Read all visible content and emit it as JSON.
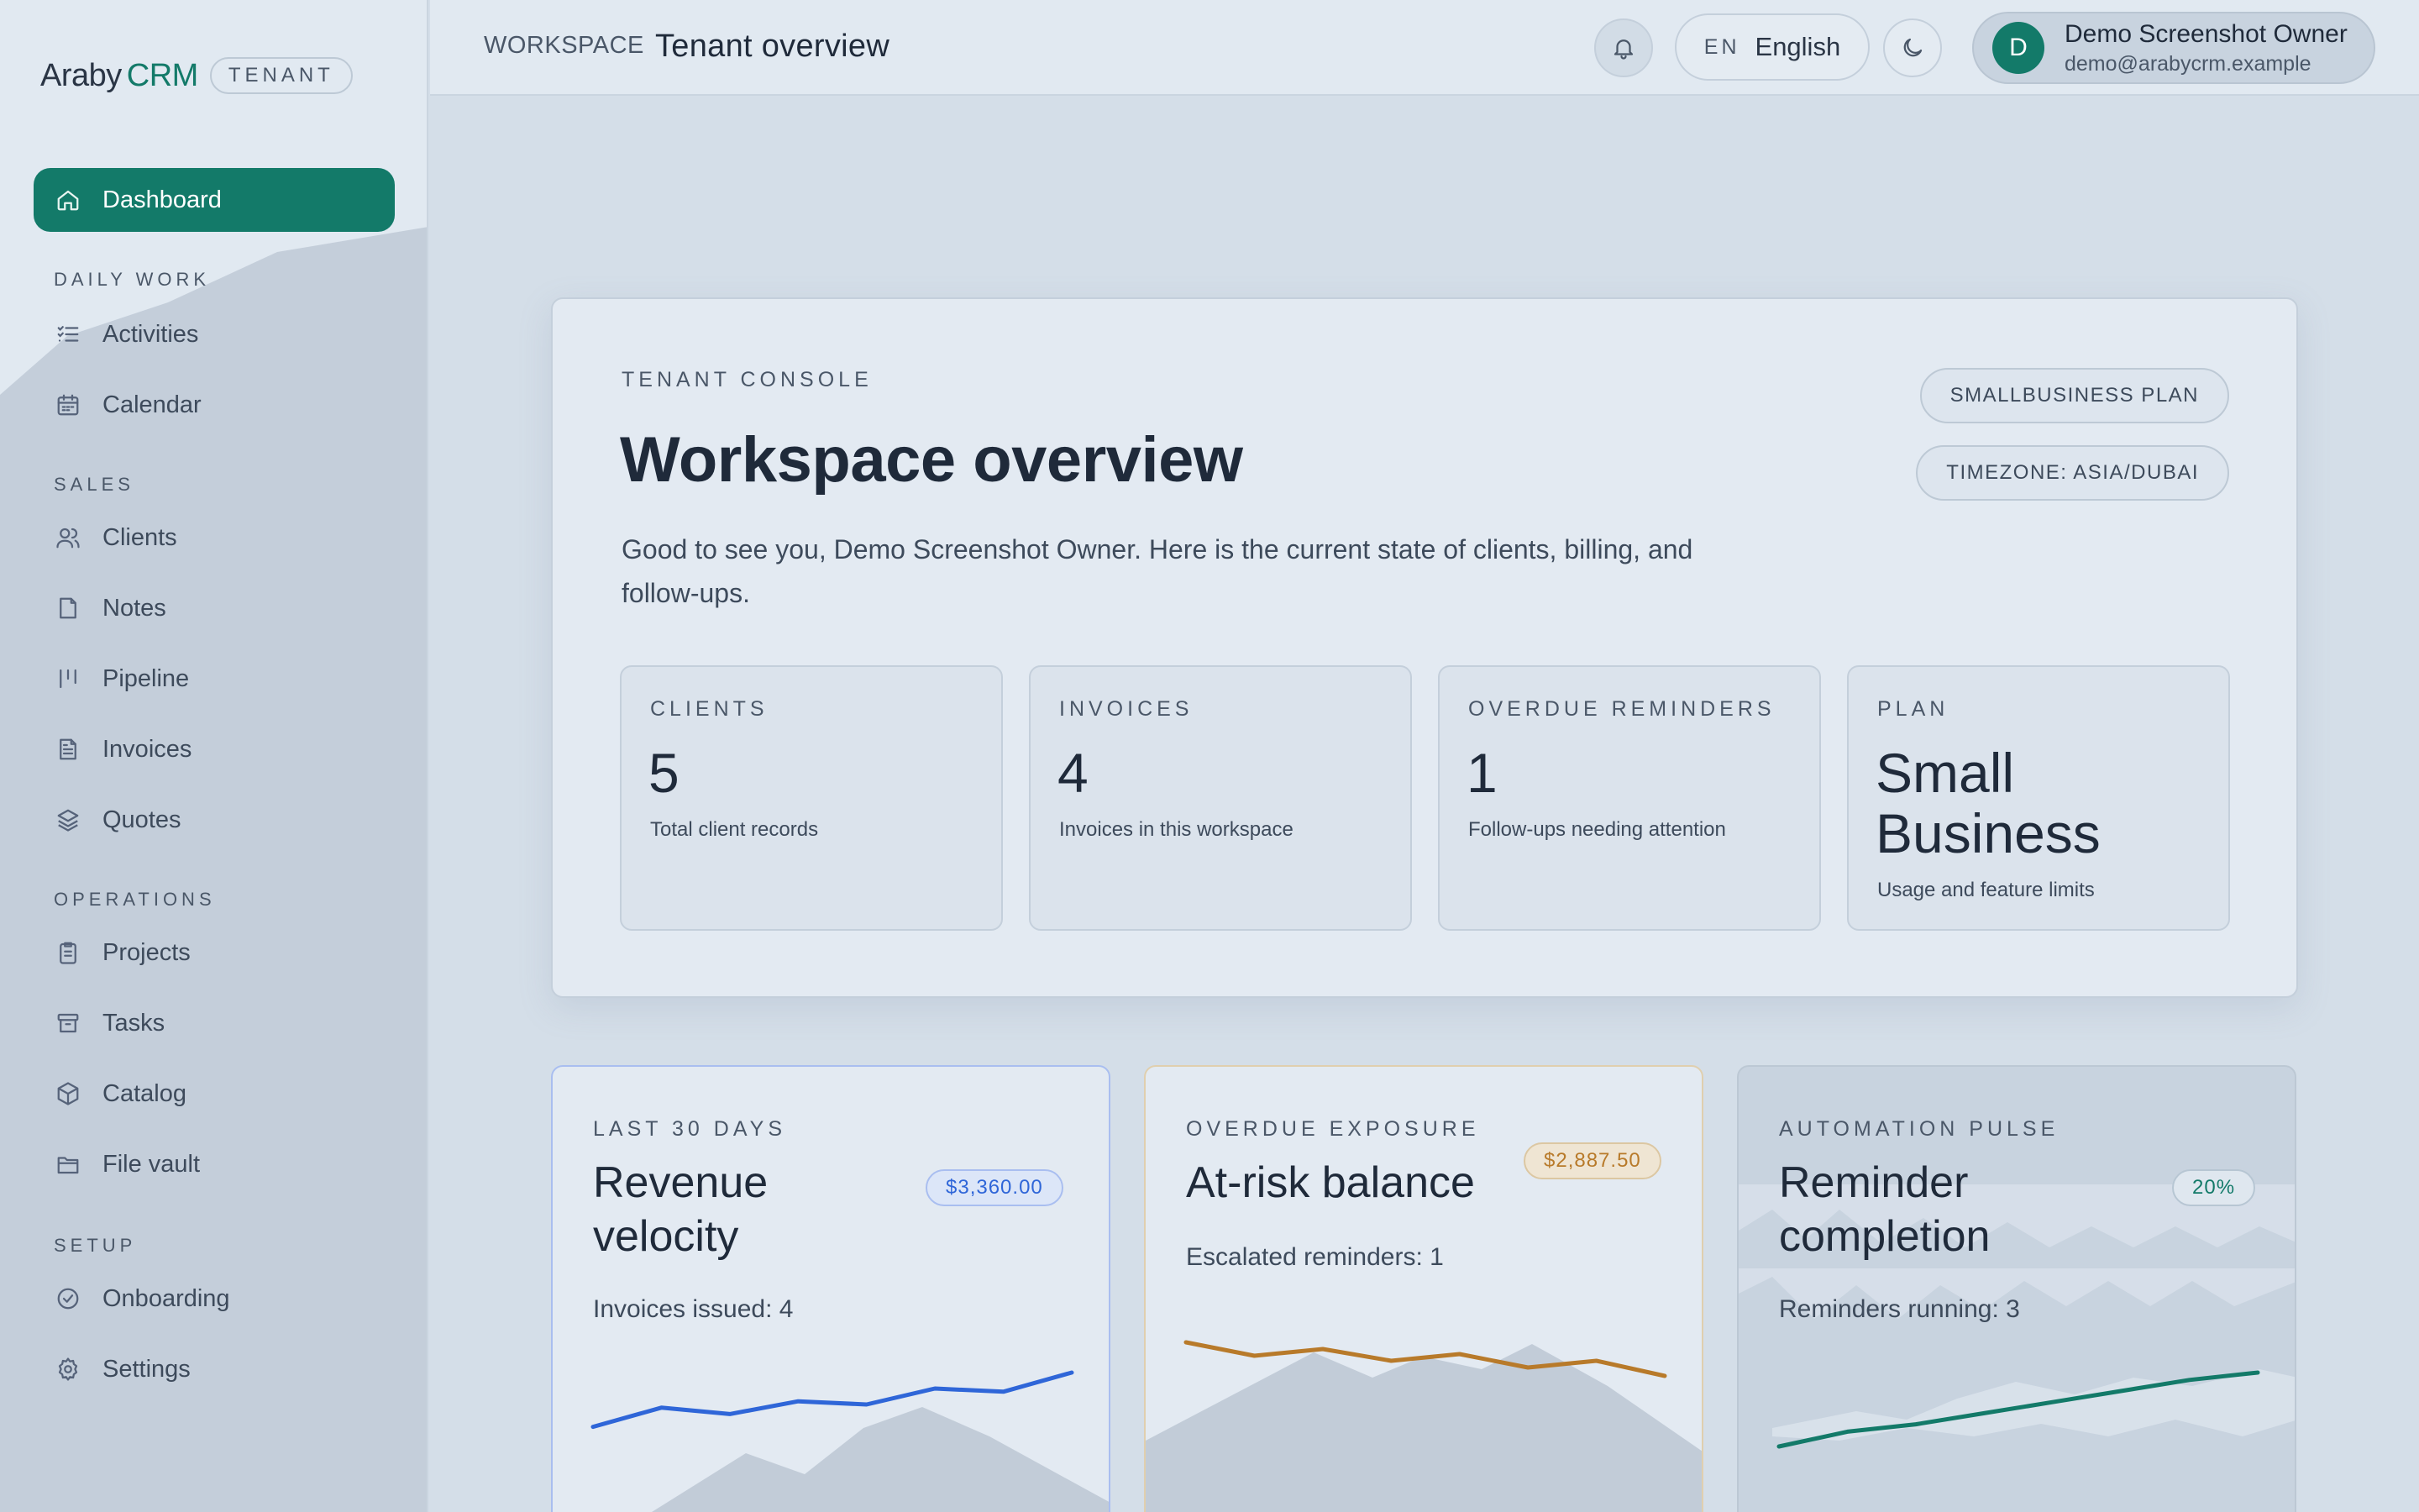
{
  "brand": {
    "name": "Araby",
    "accent": "CRM",
    "badge": "TENANT"
  },
  "sidebar": {
    "active": {
      "label": "Dashboard",
      "icon": "home-icon"
    },
    "sections": [
      {
        "title": "DAILY WORK",
        "items": [
          {
            "label": "Activities",
            "icon": "checklist-icon"
          },
          {
            "label": "Calendar",
            "icon": "calendar-icon"
          }
        ]
      },
      {
        "title": "SALES",
        "items": [
          {
            "label": "Clients",
            "icon": "users-icon"
          },
          {
            "label": "Notes",
            "icon": "note-icon"
          },
          {
            "label": "Pipeline",
            "icon": "pipeline-icon"
          },
          {
            "label": "Invoices",
            "icon": "invoice-icon"
          },
          {
            "label": "Quotes",
            "icon": "layers-icon"
          }
        ]
      },
      {
        "title": "OPERATIONS",
        "items": [
          {
            "label": "Projects",
            "icon": "clipboard-icon"
          },
          {
            "label": "Tasks",
            "icon": "archive-icon"
          },
          {
            "label": "Catalog",
            "icon": "package-icon"
          },
          {
            "label": "File vault",
            "icon": "folder-icon"
          }
        ]
      },
      {
        "title": "SETUP",
        "items": [
          {
            "label": "Onboarding",
            "icon": "check-circle-icon"
          },
          {
            "label": "Settings",
            "icon": "gear-icon"
          }
        ]
      }
    ]
  },
  "topbar": {
    "section": "WORKSPACE",
    "title": "Tenant overview",
    "language": {
      "code": "EN",
      "name": "English"
    },
    "user": {
      "initial": "D",
      "name": "Demo Screenshot Owner",
      "email": "demo@arabycrm.example"
    }
  },
  "console": {
    "eyebrow": "TENANT CONSOLE",
    "title": "Workspace overview",
    "description": "Good to see you, Demo Screenshot Owner. Here is the current state of clients, billing, and follow-ups.",
    "plan_pill": "SMALLBUSINESS PLAN",
    "timezone_pill": "TIMEZONE: ASIA/DUBAI",
    "stats": [
      {
        "label": "CLIENTS",
        "value": "5",
        "sub": "Total client records"
      },
      {
        "label": "INVOICES",
        "value": "4",
        "sub": "Invoices in this workspace"
      },
      {
        "label": "OVERDUE REMINDERS",
        "value": "1",
        "sub": "Follow-ups needing attention"
      },
      {
        "label": "PLAN",
        "value": "Small Business",
        "sub": "Usage and feature limits"
      }
    ]
  },
  "metrics": [
    {
      "eyebrow": "LAST 30 DAYS",
      "title": "Revenue velocity",
      "badge": "$3,360.00",
      "sub": "Invoices issued: 4",
      "color": "#2f66d8",
      "trend": [
        0.15,
        0.45,
        0.35,
        0.55,
        0.5,
        0.75,
        0.7,
        1.0
      ]
    },
    {
      "eyebrow": "OVERDUE EXPOSURE",
      "title": "At-risk balance",
      "badge": "$2,887.50",
      "sub": "Escalated reminders: 1",
      "color": "#b87a2a",
      "trend": [
        1.0,
        0.6,
        0.8,
        0.45,
        0.65,
        0.25,
        0.45,
        0.0
      ]
    },
    {
      "eyebrow": "AUTOMATION PULSE",
      "title": "Reminder completion",
      "badge": "20%",
      "sub": "Reminders running: 3",
      "color": "#137a69",
      "trend": [
        0.0,
        0.2,
        0.3,
        0.45,
        0.6,
        0.75,
        0.9,
        1.0
      ]
    }
  ],
  "colors": {
    "accent": "#137a69",
    "background": "#d4dee8",
    "panel": "#e3eaf2"
  }
}
